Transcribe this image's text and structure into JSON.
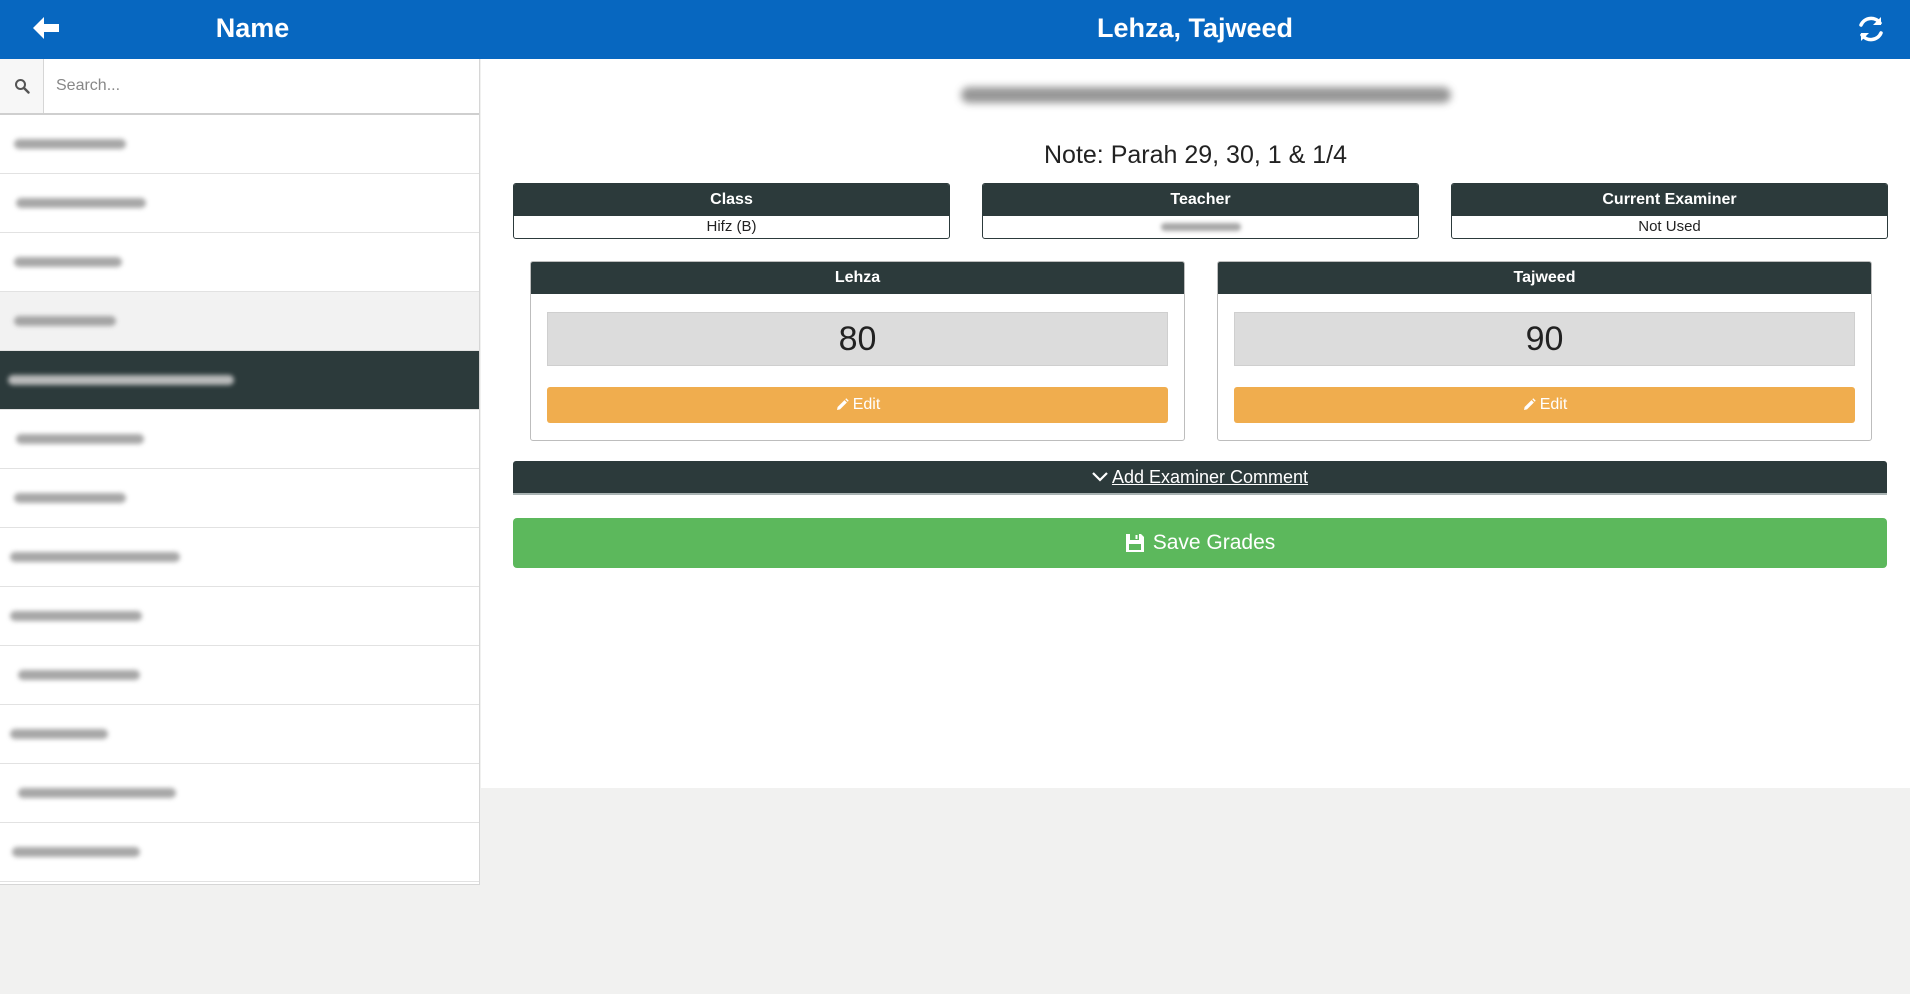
{
  "header": {
    "back_icon": "arrow-left-icon",
    "sidebar_title": "Name",
    "title": "Lehza, Tajweed",
    "refresh_icon": "refresh-icon",
    "bg_color": "#0767c0"
  },
  "sidebar": {
    "search": {
      "placeholder": "Search...",
      "value": "",
      "icon": "search-icon"
    },
    "students": [
      {
        "state": "normal"
      },
      {
        "state": "normal"
      },
      {
        "state": "normal"
      },
      {
        "state": "hover"
      },
      {
        "state": "selected"
      },
      {
        "state": "normal"
      },
      {
        "state": "normal"
      },
      {
        "state": "normal"
      },
      {
        "state": "normal"
      },
      {
        "state": "normal"
      },
      {
        "state": "normal"
      },
      {
        "state": "normal"
      },
      {
        "state": "normal"
      }
    ]
  },
  "main": {
    "note": "Note: Parah 29, 30, 1 & 1/4",
    "info": {
      "class_label": "Class",
      "class_value": "Hifz (B)",
      "teacher_label": "Teacher",
      "examiner_label": "Current Examiner",
      "examiner_value": "Not Used"
    },
    "grades": [
      {
        "label": "Lehza",
        "value": "80",
        "edit_label": "Edit"
      },
      {
        "label": "Tajweed",
        "value": "90",
        "edit_label": "Edit"
      }
    ],
    "comment_label": "Add Examiner Comment",
    "save_label": "Save Grades"
  },
  "colors": {
    "dark_header": "#2c3a3b",
    "edit_button": "#f0ad4e",
    "save_button": "#5cb85c"
  }
}
